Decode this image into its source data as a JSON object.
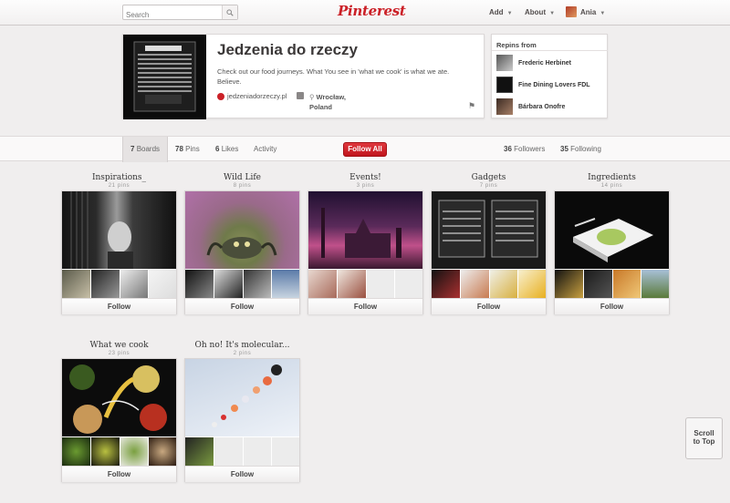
{
  "header": {
    "search_placeholder": "Search",
    "logo": "Pinterest",
    "add_label": "Add",
    "about_label": "About",
    "user_name": "Ania"
  },
  "profile": {
    "name": "Jedzenia do rzeczy",
    "description": "Check out our food journeys. What You see in 'what we cook' is what we ate. Believe.",
    "website": "jedzeniadorzeczy.pl",
    "location_line1": "Wrocław,",
    "location_line2": "Poland"
  },
  "repins": {
    "title": "Repins from",
    "items": [
      {
        "name": "Frederic Herbinet"
      },
      {
        "name": "Fine Dining Lovers FDL"
      },
      {
        "name": "Bárbara Onofre"
      }
    ]
  },
  "tabs": {
    "boards_count": "7",
    "boards_label": "Boards",
    "pins_count": "78",
    "pins_label": "Pins",
    "likes_count": "6",
    "likes_label": "Likes",
    "activity_label": "Activity",
    "follow_all": "Follow All",
    "followers_count": "36",
    "followers_label": "Followers",
    "following_count": "35",
    "following_label": "Following"
  },
  "boards": [
    {
      "title": "Inspirations_",
      "count": "21 pins",
      "follow": "Follow"
    },
    {
      "title": "Wild Life",
      "count": "8 pins",
      "follow": "Follow"
    },
    {
      "title": "Events!",
      "count": "3 pins",
      "follow": "Follow"
    },
    {
      "title": "Gadgets",
      "count": "7 pins",
      "follow": "Follow"
    },
    {
      "title": "Ingredients",
      "count": "14 pins",
      "follow": "Follow"
    },
    {
      "title": "What we cook",
      "count": "23 pins",
      "follow": "Follow"
    },
    {
      "title": "Oh no! It's molecular...",
      "count": "2 pins",
      "follow": "Follow"
    }
  ],
  "scroll_top": {
    "line1": "Scroll",
    "line2": "to Top"
  },
  "colors": {
    "accent": "#cb2027",
    "background": "#f0eeee"
  }
}
